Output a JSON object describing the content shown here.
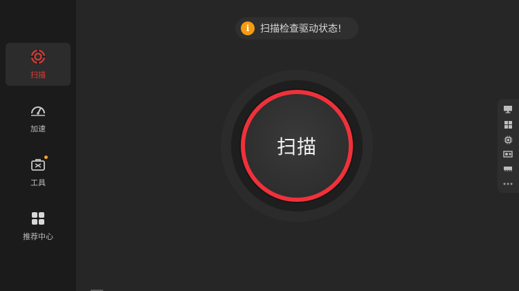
{
  "sidebar": {
    "items": [
      {
        "label": "扫描",
        "icon": "scan-icon",
        "active": true
      },
      {
        "label": "加速",
        "icon": "speedometer-icon",
        "active": false
      },
      {
        "label": "工具",
        "icon": "toolbox-icon",
        "active": false,
        "badge": true
      },
      {
        "label": "推荐中心",
        "icon": "grid-icon",
        "active": false
      }
    ]
  },
  "notice": {
    "icon": "info-icon",
    "icon_text": "i",
    "text": "扫描检查驱动状态!"
  },
  "main": {
    "scan_button_label": "扫描"
  },
  "side_tools": [
    "monitor-icon",
    "windows-icon",
    "cpu-icon",
    "graphics-card-icon",
    "memory-icon",
    "more-icon"
  ],
  "colors": {
    "accent": "#f0313a",
    "background": "#262626",
    "sidebar": "#1b1b1b",
    "badge": "#f5a623",
    "info": "#f39c12"
  }
}
